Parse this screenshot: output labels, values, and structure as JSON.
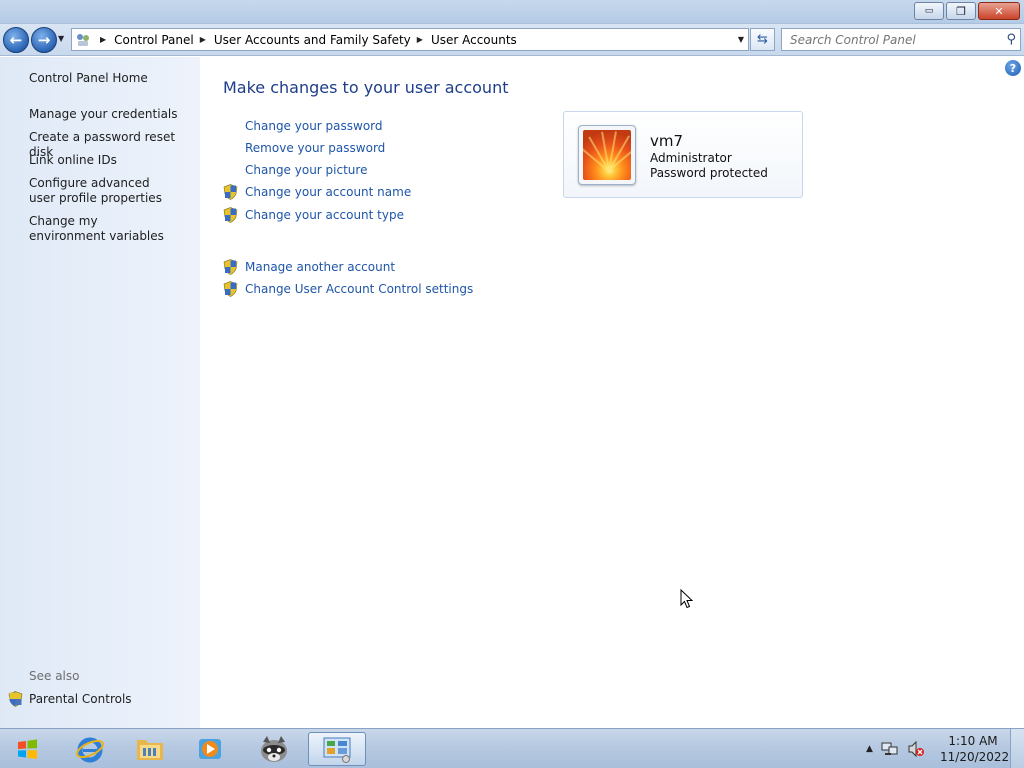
{
  "window": {
    "minimize_label": "▭",
    "maximize_label": "❐",
    "close_label": "✕"
  },
  "address": {
    "breadcrumbs": [
      "Control Panel",
      "User Accounts and Family Safety",
      "User Accounts"
    ]
  },
  "search": {
    "placeholder": "Search Control Panel"
  },
  "sidebar": {
    "home": "Control Panel Home",
    "items": [
      {
        "label": "Manage your credentials"
      },
      {
        "label": "Create a password reset disk"
      },
      {
        "label": "Link online IDs"
      },
      {
        "label": "Configure advanced user profile properties"
      },
      {
        "label": "Change my environment variables"
      }
    ],
    "see_also_label": "See also",
    "see_also_items": [
      {
        "label": "Parental Controls"
      }
    ]
  },
  "main": {
    "title": "Make changes to your user account",
    "tasks": [
      {
        "label": "Change your password",
        "shield": false
      },
      {
        "label": "Remove your password",
        "shield": false
      },
      {
        "label": "Change your picture",
        "shield": false
      },
      {
        "label": "Change your account name",
        "shield": true
      },
      {
        "label": "Change your account type",
        "shield": true
      }
    ],
    "other_tasks": [
      {
        "label": "Manage another account",
        "shield": true
      },
      {
        "label": "Change User Account Control settings",
        "shield": true
      }
    ],
    "user": {
      "name": "vm7",
      "role": "Administrator",
      "status": "Password protected"
    }
  },
  "taskbar": {
    "apps": [
      "internet-explorer",
      "windows-explorer",
      "media-player",
      "raccoon-app",
      "control-panel"
    ],
    "active_app": "control-panel",
    "clock_time": "1:10 AM",
    "clock_date": "11/20/2022"
  },
  "colors": {
    "link": "#1f56a8",
    "title": "#1e3e8a",
    "sidebar_bg": "#e4edf8"
  }
}
